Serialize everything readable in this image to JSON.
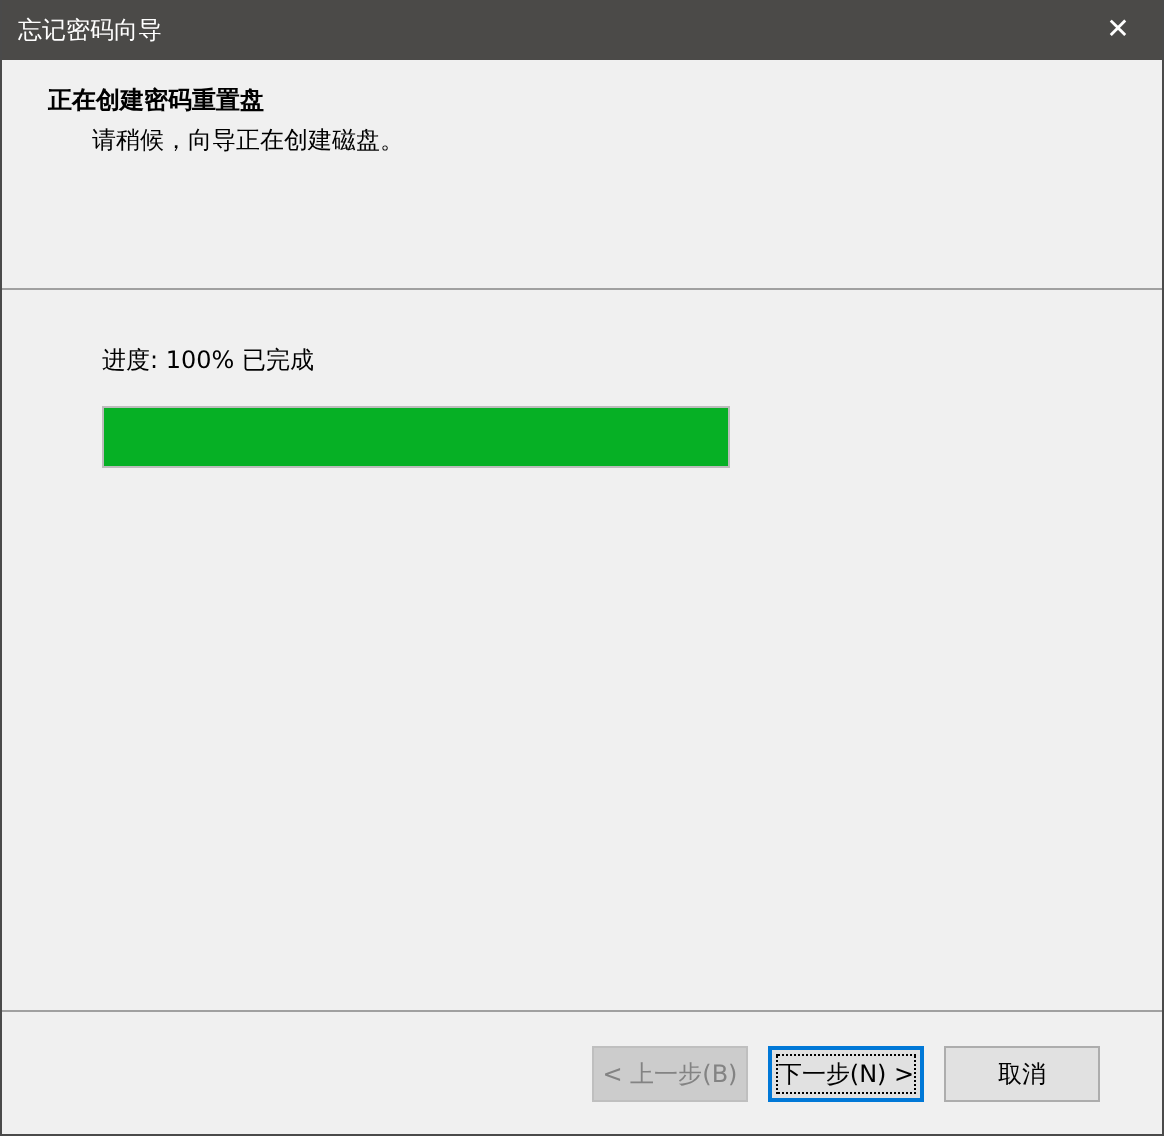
{
  "window": {
    "title": "忘记密码向导",
    "close": "✕"
  },
  "header": {
    "title": "正在创建密码重置盘",
    "subtitle": "请稍候，向导正在创建磁盘。"
  },
  "progress": {
    "label": "进度: 100% 已完成",
    "level": 1
  },
  "buttons": [
    {
      "label": "< 上一步(B)",
      "disabled": true,
      "focused": false
    },
    {
      "label": "下一步(N) >",
      "disabled": false,
      "focused": true
    },
    {
      "label": "取消",
      "disabled": false,
      "focused": false
    }
  ]
}
